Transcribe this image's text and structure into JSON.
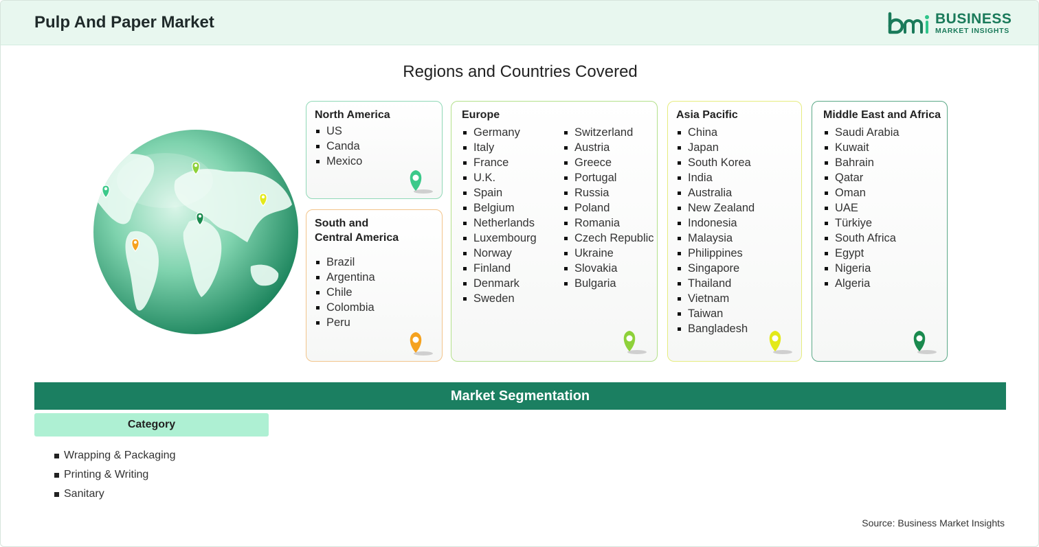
{
  "header": {
    "title": "Pulp And Paper Market"
  },
  "logo": {
    "word1": "BUSINESS",
    "word2": "MARKET INSIGHTS",
    "mark": "bmi",
    "color": "#1a7a5a"
  },
  "regions_title": "Regions and Countries Covered",
  "regions": {
    "north_america": {
      "name": "North America",
      "items": [
        "US",
        "Canda",
        "Mexico"
      ],
      "pin_color": "#3cc98a"
    },
    "south_central_america": {
      "name_line1": "South and",
      "name_line2": "Central America",
      "items": [
        "Brazil",
        "Argentina",
        "Chile",
        "Colombia",
        "Peru"
      ],
      "pin_color": "#f5a21f"
    },
    "europe": {
      "name": "Europe",
      "col1": [
        "Germany",
        "Italy",
        "France",
        "U.K.",
        "Spain",
        "Belgium",
        "Netherlands",
        "Luxembourg",
        "Norway",
        "Finland",
        "Denmark",
        "Sweden"
      ],
      "col2": [
        "Switzerland",
        "Austria",
        "Greece",
        "Portugal",
        "Russia",
        "Poland",
        "Romania",
        "Czech Republic",
        "Ukraine",
        "Slovakia",
        "Bulgaria"
      ],
      "pin_color": "#8ed13a"
    },
    "asia_pacific": {
      "name": "Asia Pacific",
      "items": [
        "China",
        "Japan",
        "South Korea",
        "India",
        "Australia",
        "New Zealand",
        "Indonesia",
        "Malaysia",
        "Philippines",
        "Singapore",
        "Thailand",
        "Vietnam",
        "Taiwan",
        "Bangladesh"
      ],
      "pin_color": "#e3e91a"
    },
    "middle_east_africa": {
      "name": "Middle East and Africa",
      "items": [
        "Saudi Arabia",
        "Kuwait",
        "Bahrain",
        "Qatar",
        "Oman",
        "UAE",
        "Türkiye",
        "South Africa",
        "Egypt",
        "Nigeria",
        "Algeria"
      ],
      "pin_color": "#1a8a4e"
    }
  },
  "segmentation": {
    "title": "Market Segmentation",
    "category_label": "Category",
    "categories": [
      "Wrapping & Packaging",
      "Printing & Writing",
      "Sanitary"
    ]
  },
  "source": "Source: Business Market Insights",
  "colors": {
    "accent": "#1b7f61",
    "header_bg": "#e8f7ef",
    "tab_bg": "#aef0d3"
  }
}
